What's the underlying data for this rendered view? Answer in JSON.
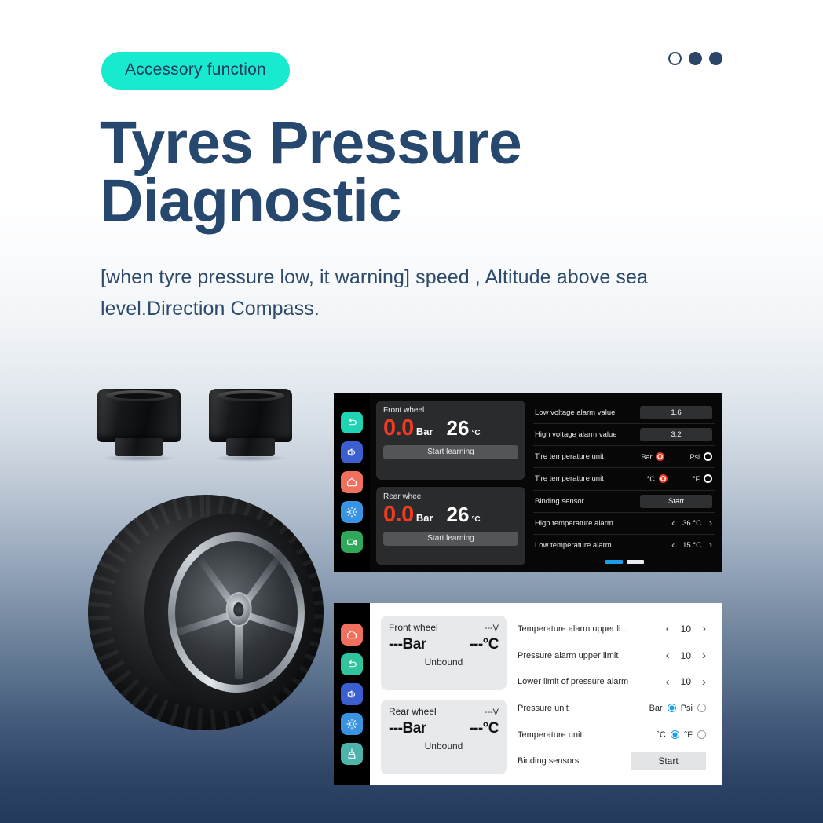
{
  "hero": {
    "badge": "Accessory function",
    "headline": "Tyres Pressure Diagnostic",
    "subtitle": "[when tyre pressure low, it warning] speed , Altitude above sea level.Direction Compass.",
    "dots": [
      "hollow",
      "solid",
      "solid"
    ],
    "colors": {
      "badge_bg": "#18ead0",
      "badge_text": "#1f3a5f",
      "headline": "#27486e",
      "subtitle": "#2d4a6b",
      "dot": "#2b4668",
      "page_bg_top": "#ffffff",
      "page_bg_bottom": "#23395c"
    }
  },
  "product_images": {
    "sensor_caps_label": "tpms-sensor-caps",
    "tyre_label": "motorcycle-tyre-wheel"
  },
  "device_dark": {
    "rail_icons": [
      "back-icon",
      "speaker-icon",
      "home-icon",
      "brightness-icon",
      "camera-icon"
    ],
    "wheels": [
      {
        "label": "Front wheel",
        "pressure": "0.0",
        "pressure_unit": "Bar",
        "temperature": "26",
        "temperature_unit": "°C",
        "button": "Start learning"
      },
      {
        "label": "Rear wheel",
        "pressure": "0.0",
        "pressure_unit": "Bar",
        "temperature": "26",
        "temperature_unit": "°C",
        "button": "Start learning"
      }
    ],
    "settings": [
      {
        "label": "Low voltage alarm value",
        "type": "value",
        "value": "1.6"
      },
      {
        "label": "High voltage alarm value",
        "type": "value",
        "value": "3.2"
      },
      {
        "label": "Tire temperature unit",
        "type": "radio",
        "option_a": "Bar",
        "option_b": "Psi",
        "selected": "a"
      },
      {
        "label": "Tire temperature unit",
        "type": "radio",
        "option_a": "°C",
        "option_b": "°F",
        "selected": "a"
      },
      {
        "label": "Binding sensor",
        "type": "value",
        "value": "Start"
      },
      {
        "label": "High temperature alarm",
        "type": "stepper",
        "value": "36 °C",
        "prev": "‹",
        "next": "›"
      },
      {
        "label": "Low temperature alarm",
        "type": "stepper",
        "value": "15 °C",
        "prev": "‹",
        "next": "›"
      }
    ],
    "pagination": [
      "active",
      "idle"
    ],
    "colors": {
      "bg": "#070708",
      "accent_red": "#ef3b23",
      "page_active": "#1b9fe8"
    }
  },
  "device_light": {
    "rail_icons": [
      "home-icon",
      "back-icon",
      "speaker-icon",
      "brightness-icon",
      "broom-icon"
    ],
    "wheels": [
      {
        "label": "Front wheel",
        "voltage": "---V",
        "pressure": "---Bar",
        "temperature": "---°C",
        "status": "Unbound"
      },
      {
        "label": "Rear wheel",
        "voltage": "---V",
        "pressure": "---Bar",
        "temperature": "---°C",
        "status": "Unbound"
      }
    ],
    "settings": [
      {
        "label": "Temperature alarm upper li...",
        "type": "stepper",
        "value": "10",
        "prev": "‹",
        "next": "›"
      },
      {
        "label": "Pressure alarm upper limit",
        "type": "stepper",
        "value": "10",
        "prev": "‹",
        "next": "›"
      },
      {
        "label": "Lower limit of pressure alarm",
        "type": "stepper",
        "value": "10",
        "prev": "‹",
        "next": "›"
      },
      {
        "label": "Pressure unit",
        "type": "radio",
        "option_a": "Bar",
        "option_b": "Psi",
        "selected": "a"
      },
      {
        "label": "Temperature unit",
        "type": "radio",
        "option_a": "°C",
        "option_b": "°F",
        "selected": "a"
      },
      {
        "label": "Binding sensors",
        "type": "button",
        "value": "Start"
      }
    ],
    "colors": {
      "bg": "#ffffff",
      "rail_bg": "#000000",
      "radio_on": "#1b9fe8"
    }
  }
}
